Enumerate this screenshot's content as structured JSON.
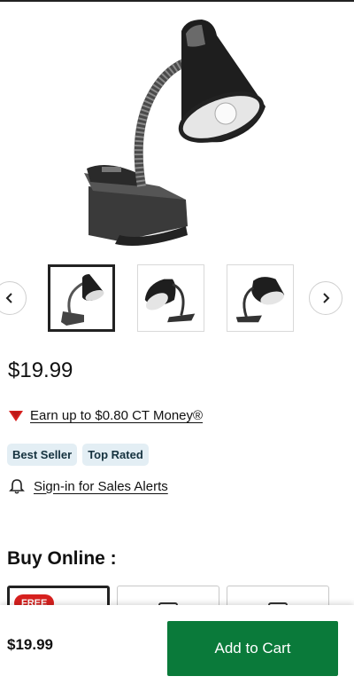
{
  "product": {
    "price": "$19.99",
    "ct_money_text": "Earn up to $0.80 CT Money®",
    "badges": [
      "Best Seller",
      "Top Rated"
    ],
    "sales_alert_text": "Sign-in for Sales Alerts"
  },
  "gallery": {
    "prev_icon": "chevron-left-icon",
    "next_icon": "chevron-right-icon",
    "selected_index": 0
  },
  "buy_online": {
    "title": "Buy Online :",
    "free_tag": "FREE"
  },
  "sticky_bar": {
    "price": "$19.99",
    "add_to_cart_label": "Add to Cart"
  },
  "colors": {
    "add_to_cart": "#0a7a3a",
    "free_tag": "#d6201e",
    "badge_bg": "#e3eef4",
    "ct_triangle": "#d6201e"
  }
}
